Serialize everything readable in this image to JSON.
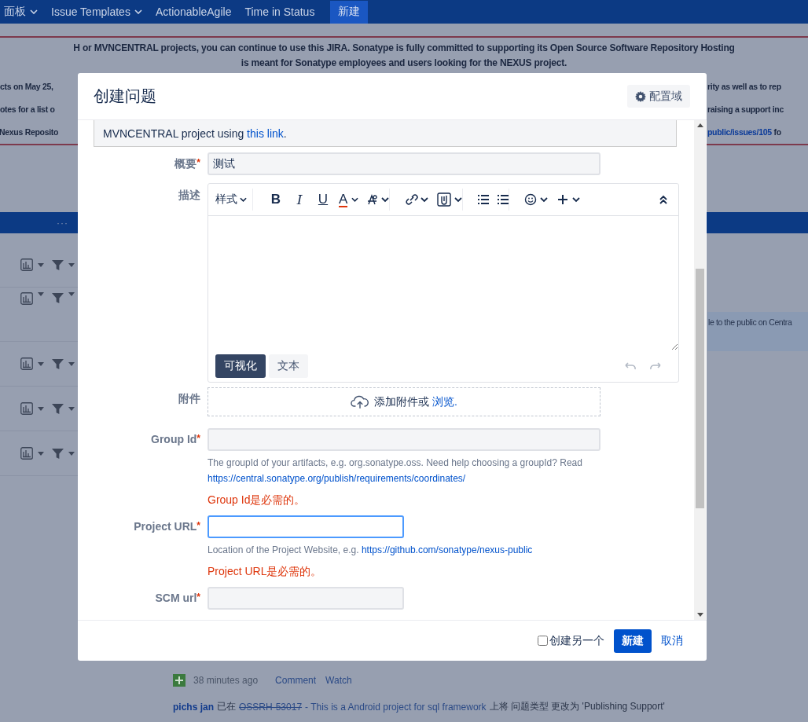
{
  "nav": {
    "items": [
      {
        "label": "面板",
        "dropdown": true
      },
      {
        "label": "Issue Templates",
        "dropdown": true
      },
      {
        "label": "ActionableAgile",
        "dropdown": false
      },
      {
        "label": "Time in Status",
        "dropdown": false
      }
    ],
    "create_button": "新建"
  },
  "banner": {
    "lines": [
      "H or MVNCENTRAL projects, you can continue to use this JIRA. Sonatype is fully committed to supporting its Open Source Software Repository Hosting",
      "is meant for Sonatype employees and users looking for the NEXUS project."
    ],
    "left_fragments": [
      "cts on May 25,",
      "otes for a list o",
      "Nexus Reposito"
    ],
    "right_fragments": [
      {
        "text": "rity as well as to rep",
        "link": false
      },
      {
        "text": "raising a support inc",
        "link": false
      },
      {
        "text": "public/issues/105",
        "link": true,
        "tail": " fo"
      }
    ]
  },
  "table_header": {
    "more": "···"
  },
  "side_text": "le to the public on Centra",
  "activity": {
    "time": "38 minutes ago",
    "actions": [
      "Comment",
      "Watch"
    ]
  },
  "last_entry": {
    "user": "pichs jan",
    "verb": "已在",
    "issue_key": "OSSRH-53017",
    "resolved": true,
    "issue_title": "- This is a Android project for sql framework",
    "rest": "上将 问题类型 更改为 'Publishing Support'"
  },
  "dialog": {
    "title": "创建问题",
    "configure_button": "配置域",
    "notice": {
      "text": "MVNCENTRAL project using ",
      "link": "this link",
      "end": "."
    },
    "fields": [
      {
        "kind": "field",
        "label": "概要",
        "required_mark": "*",
        "value": "测试",
        "wide": true,
        "focused": false
      },
      {
        "kind": "editor",
        "label": "描述",
        "style_menu": "样式",
        "format_buttons": [
          "B",
          "I",
          "U"
        ],
        "color_button": "A",
        "modes": [
          {
            "label": "可视化",
            "selected": true
          },
          {
            "label": "文本",
            "selected": false
          }
        ]
      },
      {
        "kind": "attachment",
        "label": "附件",
        "prompt": "添加附件或",
        "link": "浏览."
      },
      {
        "kind": "field",
        "label": "Group Id",
        "required_mark": "*",
        "wide": true,
        "focused": false,
        "help": "The groupId of your artifacts, e.g. org.sonatype.oss. Need help choosing a groupId? Read",
        "help_link": "https://central.sonatype.org/publish/requirements/coordinates/",
        "error": "Group Id是必需的。"
      },
      {
        "kind": "field",
        "label": "Project URL",
        "required_mark": "*",
        "wide": false,
        "focused": true,
        "help": "Location of the Project Website, e.g.",
        "help_link": "https://github.com/sonatype/nexus-public",
        "error": "Project URL是必需的。"
      },
      {
        "kind": "field",
        "label": "SCM url",
        "required_mark": "*",
        "wide": false,
        "focused": false
      }
    ],
    "footer": {
      "create_another": {
        "label": "创建另一个",
        "checked": false
      },
      "submit": "新建",
      "cancel": "取消"
    }
  }
}
